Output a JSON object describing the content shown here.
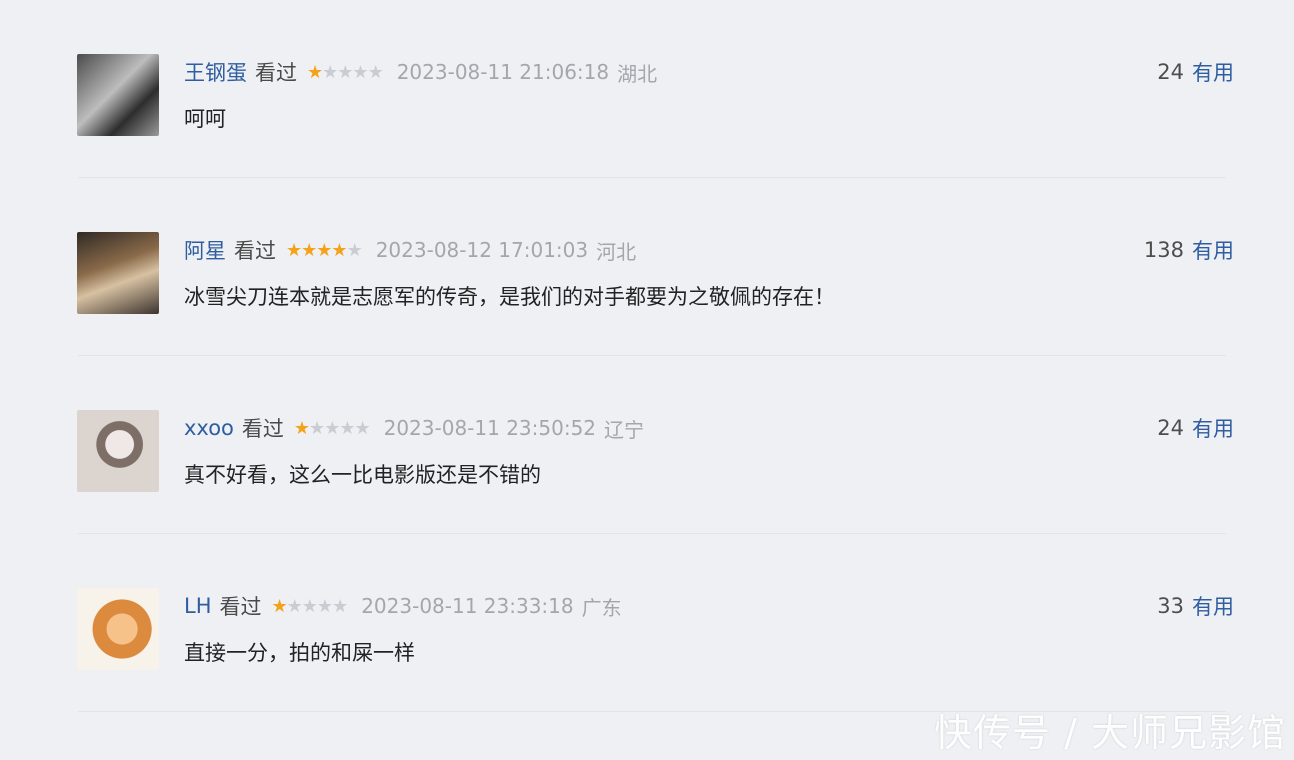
{
  "comments": [
    {
      "username": "王钢蛋",
      "status": "看过",
      "rating": 1,
      "rating_max": 5,
      "timestamp": "2023-08-11 21:06:18",
      "region": "湖北",
      "useful_count": "24",
      "useful_label": "有用",
      "text": "呵呵"
    },
    {
      "username": "阿星",
      "status": "看过",
      "rating": 4,
      "rating_max": 5,
      "timestamp": "2023-08-12 17:01:03",
      "region": "河北",
      "useful_count": "138",
      "useful_label": "有用",
      "text": "冰雪尖刀连本就是志愿军的传奇，是我们的对手都要为之敬佩的存在！"
    },
    {
      "username": "xxoo",
      "status": "看过",
      "rating": 1,
      "rating_max": 5,
      "timestamp": "2023-08-11 23:50:52",
      "region": "辽宁",
      "useful_count": "24",
      "useful_label": "有用",
      "text": "真不好看，这么一比电影版还是不错的"
    },
    {
      "username": "LH",
      "status": "看过",
      "rating": 1,
      "rating_max": 5,
      "timestamp": "2023-08-11 23:33:18",
      "region": "广东",
      "useful_count": "33",
      "useful_label": "有用",
      "text": "直接一分，拍的和屎一样"
    }
  ],
  "watermark": "快传号 / 大师兄影馆",
  "colors": {
    "username": "#2f5d9f",
    "star_on": "#f4a318",
    "star_off": "#c9ccd2",
    "meta": "#a3a7ad",
    "background": "#eef0f3"
  }
}
